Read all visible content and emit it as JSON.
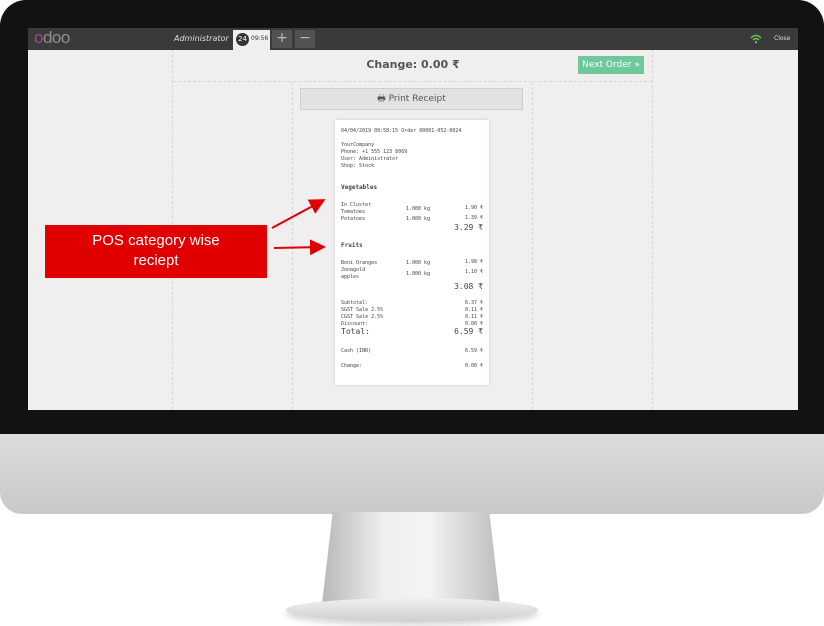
{
  "app": {
    "logo": "odoo"
  },
  "topbar": {
    "user": "Administrator",
    "order_number": "24",
    "order_time": "09:56",
    "add_label": "+",
    "remove_label": "−",
    "close_label": "Close",
    "wifi_color": "#6bc04b"
  },
  "payment": {
    "change_text": "Change: 0.00 ₹",
    "next_order_label": "Next Order",
    "print_receipt_label": "Print Receipt"
  },
  "receipt": {
    "header_line": "04/04/2019 09:58:15 Order 00001-052-0024",
    "company": "YourCompany",
    "phone": "Phone: +1 555 123 8069",
    "user": "User: Administrator",
    "shop": "Shop: Stock",
    "categories": [
      {
        "name": "Vegetables",
        "lines": [
          {
            "product": "In Cluster Tomatoes",
            "product_a": "In Cluster",
            "product_b": "Tomatoes",
            "qty": "1.000 kg",
            "price": "1.90 ₹"
          },
          {
            "product": "Potatoes",
            "qty": "1.000 kg",
            "price": "1.39 ₹"
          }
        ],
        "total": "3.29 ₹"
      },
      {
        "name": "Fruits",
        "lines": [
          {
            "product": "Boni Oranges",
            "qty": "1.000 kg",
            "price": "1.98 ₹"
          },
          {
            "product": "Jonagold apples",
            "product_a": "Jonagold",
            "product_b": "apples",
            "qty": "1.000 kg",
            "price": "1.10 ₹"
          }
        ],
        "total": "3.08 ₹"
      }
    ],
    "summary": {
      "subtotal_label": "Subtotal:",
      "subtotal": "6.37 ₹",
      "sgst_label": "SGST Sale 2.5%",
      "sgst": "0.11 ₹",
      "cgst_label": "CGST Sale 2.5%",
      "cgst": "0.11 ₹",
      "discount_label": "Discount:",
      "discount": "0.00 ₹",
      "total_label": "Total:",
      "total": "6.59 ₹",
      "cash_label": "Cash (INR)",
      "cash": "6.59 ₹",
      "change_label": "Change:",
      "change": "0.00 ₹"
    }
  },
  "annotation": {
    "text": "POS category wise reciept",
    "line1": "POS category wise",
    "line2": "reciept",
    "color": "#e10000"
  }
}
